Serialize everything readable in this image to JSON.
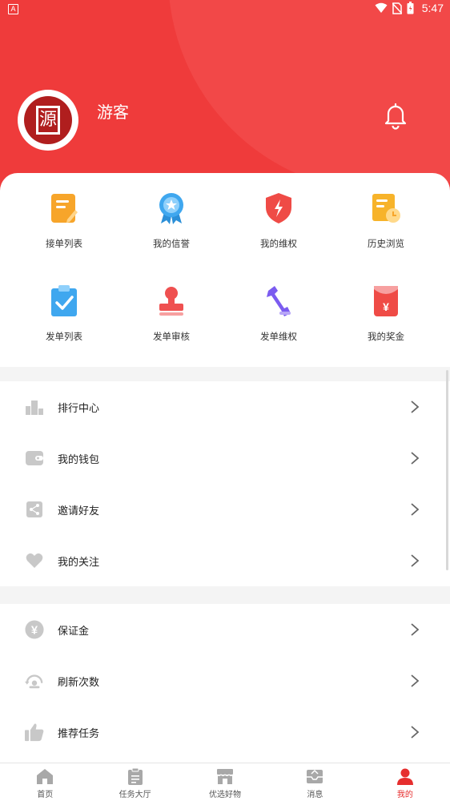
{
  "status_bar": {
    "time": "5:47",
    "indicator": "A"
  },
  "profile": {
    "username": "游客"
  },
  "grid": [
    {
      "label": "接单列表",
      "icon": "order-list-icon",
      "color": "#f7a52a"
    },
    {
      "label": "我的信誉",
      "icon": "credit-badge-icon",
      "color": "#3fa7ef"
    },
    {
      "label": "我的维权",
      "icon": "shield-icon",
      "color": "#ef4b46"
    },
    {
      "label": "历史浏览",
      "icon": "history-icon",
      "color": "#f7b32a"
    },
    {
      "label": "发单列表",
      "icon": "clipboard-check-icon",
      "color": "#3fa7ef"
    },
    {
      "label": "发单审核",
      "icon": "stamp-icon",
      "color": "#ef5050"
    },
    {
      "label": "发单维权",
      "icon": "wrench-icon",
      "color": "#7b5cf0"
    },
    {
      "label": "我的奖金",
      "icon": "red-envelope-icon",
      "color": "#ef4b46"
    }
  ],
  "list_group_1": [
    {
      "label": "排行中心",
      "icon": "ranking-icon"
    },
    {
      "label": "我的钱包",
      "icon": "wallet-icon"
    },
    {
      "label": "邀请好友",
      "icon": "invite-icon"
    },
    {
      "label": "我的关注",
      "icon": "heart-icon"
    }
  ],
  "list_group_2": [
    {
      "label": "保证金",
      "icon": "yuan-icon"
    },
    {
      "label": "刷新次数",
      "icon": "refresh-icon"
    },
    {
      "label": "推荐任务",
      "icon": "thumbs-up-icon"
    }
  ],
  "tabs": [
    {
      "label": "首页",
      "icon": "home-icon",
      "active": false
    },
    {
      "label": "任务大厅",
      "icon": "task-hall-icon",
      "active": false
    },
    {
      "label": "优选好物",
      "icon": "store-icon",
      "active": false
    },
    {
      "label": "消息",
      "icon": "message-icon",
      "active": false
    },
    {
      "label": "我的",
      "icon": "person-icon",
      "active": true
    }
  ],
  "colors": {
    "header": "#ef3b3b",
    "accent": "#e62e2e",
    "icon_gray": "#c8c8c8"
  }
}
